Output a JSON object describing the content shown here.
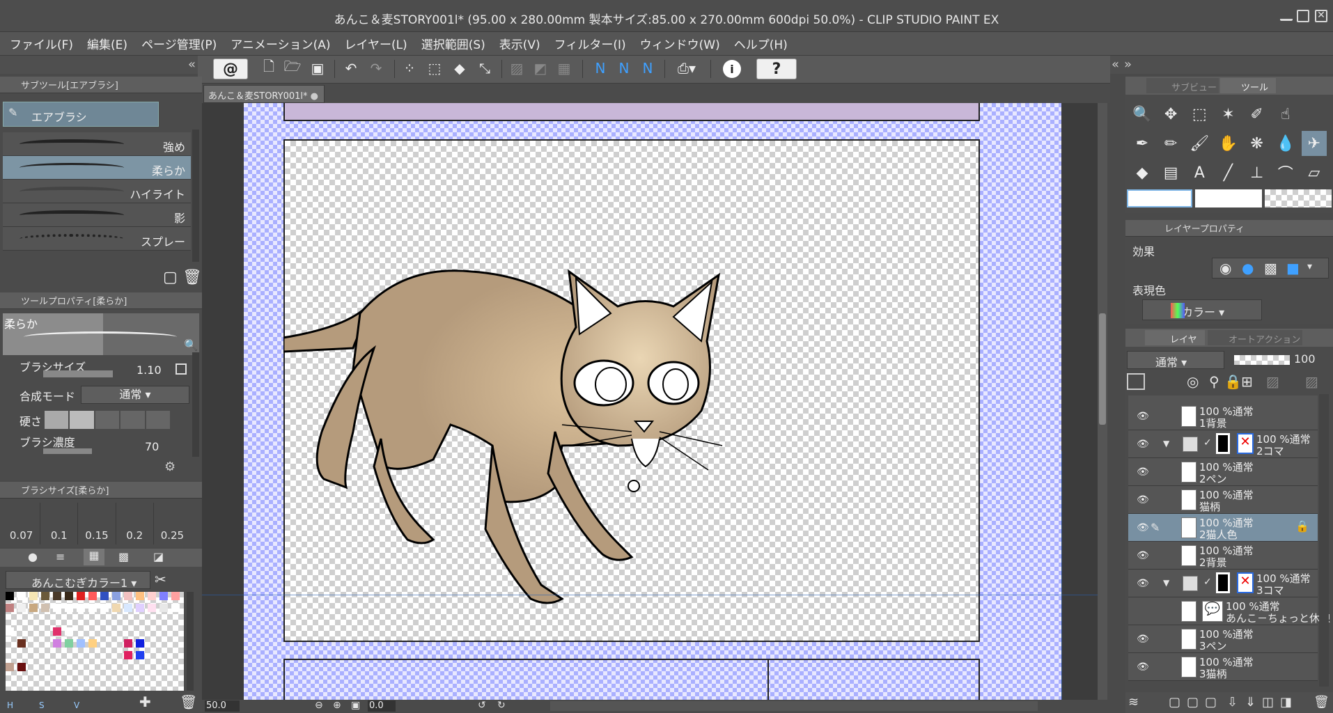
{
  "window": {
    "title": "あんこ＆麦STORY001l* (95.00 x 280.00mm 製本サイズ:85.00 x 270.00mm 600dpi 50.0%)  - CLIP STUDIO PAINT EX"
  },
  "menu": [
    "ファイル(F)",
    "編集(E)",
    "ページ管理(P)",
    "アニメーション(A)",
    "レイヤー(L)",
    "選択範囲(S)",
    "表示(V)",
    "フィルター(I)",
    "ウィンドウ(W)",
    "ヘルプ(H)"
  ],
  "canvas_tab": {
    "label": "あんこ＆麦STORY001l*"
  },
  "subtool": {
    "header": "サブツール[エアブラシ]",
    "group_button": "エアブラシ",
    "brushes": [
      "強め",
      "柔らか",
      "ハイライト",
      "影",
      "スプレー"
    ],
    "selected": "柔らか"
  },
  "tool_property": {
    "header": "ツールプロパティ[柔らか]",
    "preview_label": "柔らか",
    "brush_size_label": "ブラシサイズ",
    "brush_size_value": "1.10",
    "blend_mode_label": "合成モード",
    "blend_mode_value": "通常",
    "hardness_label": "硬さ",
    "density_label": "ブラシ濃度",
    "density_value": "70"
  },
  "brush_size_panel": {
    "header": "ブラシサイズ[柔らか]",
    "sizes": [
      "0.07",
      "0.1",
      "0.15",
      "0.2",
      "0.25"
    ]
  },
  "color_set": {
    "name": "あんこむぎカラー1",
    "footer": [
      "H",
      "S",
      "V"
    ]
  },
  "right_tabs": {
    "subview": "サブビュー",
    "tool": "ツール"
  },
  "layer_property": {
    "header": "レイヤープロパティ",
    "effect_label": "効果",
    "express_color_label": "表現色",
    "express_color_value": "カラー"
  },
  "layer_panel": {
    "tab_layer": "レイヤー",
    "tab_autoaction": "オートアクション",
    "blend_mode": "通常",
    "opacity": "100",
    "layers": [
      {
        "l1": "100 %通常",
        "l2": "1背景",
        "folder": false,
        "selected": false
      },
      {
        "l1": "100 %通常",
        "l2": "2コマ",
        "folder": true,
        "selected": false
      },
      {
        "l1": "100 %通常",
        "l2": "2ペン",
        "folder": false,
        "selected": false
      },
      {
        "l1": "100 %通常",
        "l2": "猫柄",
        "folder": false,
        "selected": false
      },
      {
        "l1": "100 %通常",
        "l2": "2猫人色",
        "folder": false,
        "selected": true
      },
      {
        "l1": "100 %通常",
        "l2": "2背景",
        "folder": false,
        "selected": false
      },
      {
        "l1": "100 %通常",
        "l2": "3コマ",
        "folder": true,
        "selected": false
      },
      {
        "l1": "100 %通常",
        "l2": "あんこ－ちょっと休憩",
        "folder": false,
        "selected": false
      },
      {
        "l1": "100 %通常",
        "l2": "3ペン",
        "folder": false,
        "selected": false
      },
      {
        "l1": "100 %通常",
        "l2": "3猫柄",
        "folder": false,
        "selected": false
      }
    ]
  },
  "status": {
    "zoom": "50.0",
    "angle": "0.0"
  },
  "colors": {
    "panel": "#4b4b4b",
    "selected": "#7890a2",
    "cat_fill": "#b59b7c",
    "cat_light": "#d8bf98"
  }
}
